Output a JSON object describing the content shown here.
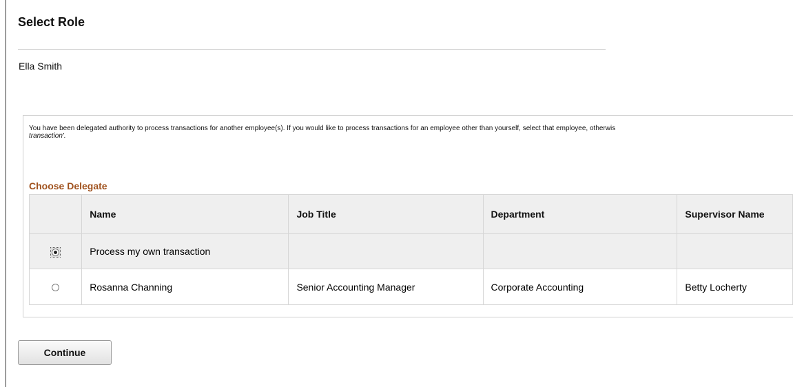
{
  "page": {
    "title": "Select Role",
    "user_name": "Ella Smith"
  },
  "instructions": {
    "line1": "You have been delegated authority to process transactions for another employee(s). If you would like to process transactions for an employee other than yourself, select that employee, otherwis",
    "line2": "transaction'."
  },
  "delegate_section": {
    "title": "Choose Delegate",
    "columns": [
      "",
      "Name",
      "Job Title",
      "Department",
      "Supervisor Name"
    ],
    "rows": [
      {
        "selected": true,
        "name": "Process my own transaction",
        "job_title": "",
        "department": "",
        "supervisor": ""
      },
      {
        "selected": false,
        "name": "Rosanna Channing",
        "job_title": "Senior Accounting Manager",
        "department": "Corporate Accounting",
        "supervisor": "Betty Locherty"
      }
    ]
  },
  "actions": {
    "continue_label": "Continue"
  },
  "colors": {
    "section_title": "#a0521e",
    "header_bg": "#efefef",
    "border": "#d6d6d6"
  }
}
